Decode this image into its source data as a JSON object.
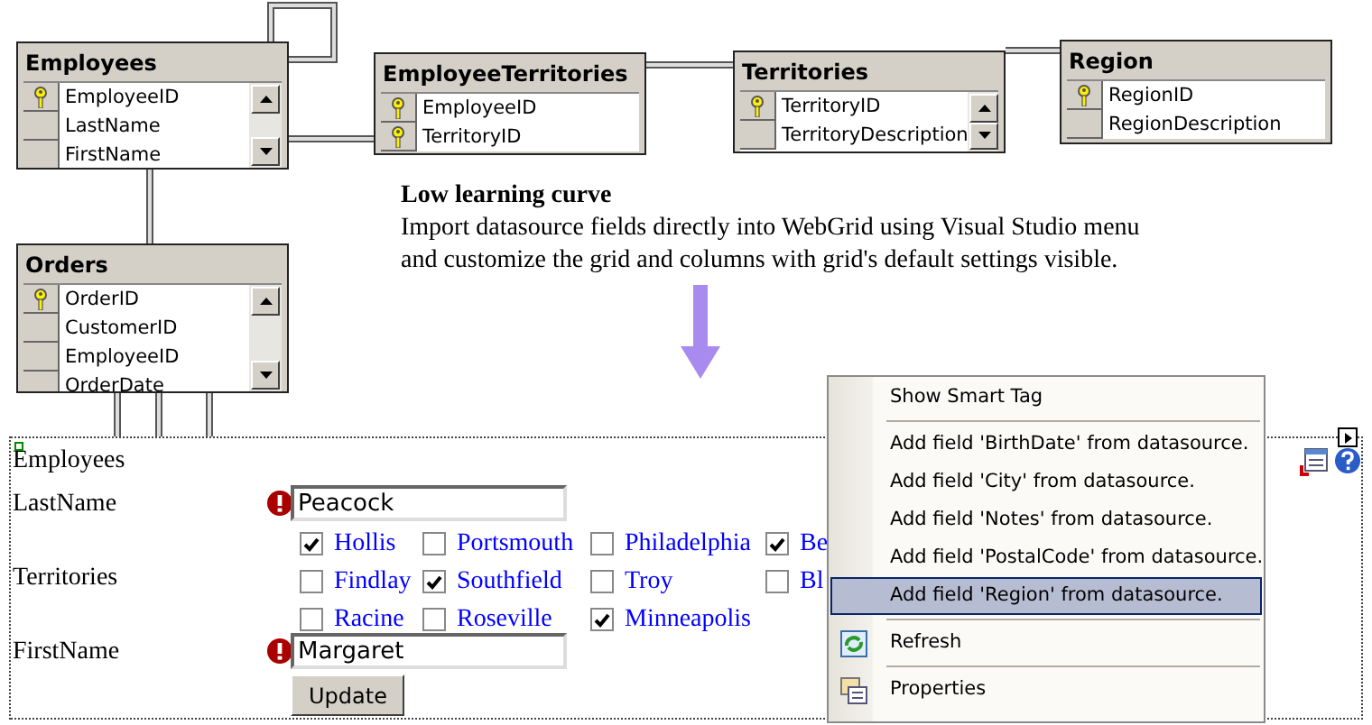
{
  "diagram": {
    "tables": [
      {
        "title": "Employees",
        "scrollbar": true,
        "columns": [
          {
            "name": "EmployeeID",
            "key": true
          },
          {
            "name": "LastName",
            "key": false
          },
          {
            "name": "FirstName",
            "key": false
          }
        ]
      },
      {
        "title": "EmployeeTerritories",
        "scrollbar": false,
        "columns": [
          {
            "name": "EmployeeID",
            "key": true
          },
          {
            "name": "TerritoryID",
            "key": true
          }
        ]
      },
      {
        "title": "Territories",
        "scrollbar": true,
        "columns": [
          {
            "name": "TerritoryID",
            "key": true
          },
          {
            "name": "TerritoryDescription",
            "key": false
          }
        ]
      },
      {
        "title": "Region",
        "scrollbar": false,
        "columns": [
          {
            "name": "RegionID",
            "key": true
          },
          {
            "name": "RegionDescription",
            "key": false
          }
        ]
      },
      {
        "title": "Orders",
        "scrollbar": true,
        "columns": [
          {
            "name": "OrderID",
            "key": true
          },
          {
            "name": "CustomerID",
            "key": false
          },
          {
            "name": "EmployeeID",
            "key": false
          },
          {
            "name": "OrderDate",
            "key": false
          }
        ]
      }
    ]
  },
  "description": {
    "heading": "Low learning curve",
    "text": "Import datasource fields directly into WebGrid using Visual Studio menu and customize the grid and columns with grid's default settings visible."
  },
  "designer": {
    "title": "Employees",
    "fields": [
      {
        "kind": "text",
        "label": "LastName",
        "value": "Peacock",
        "error": true
      },
      {
        "kind": "checklist",
        "label": "Territories",
        "items": [
          {
            "label": "Hollis",
            "checked": true
          },
          {
            "label": "Portsmouth",
            "checked": false
          },
          {
            "label": "Philadelphia",
            "checked": false
          },
          {
            "label": "Be",
            "checked": true
          },
          {
            "label": "Findlay",
            "checked": false
          },
          {
            "label": "Southfield",
            "checked": true
          },
          {
            "label": "Troy",
            "checked": false
          },
          {
            "label": "Bl",
            "checked": false
          },
          {
            "label": "Racine",
            "checked": false
          },
          {
            "label": "Roseville",
            "checked": false
          },
          {
            "label": "Minneapolis",
            "checked": true
          }
        ]
      },
      {
        "kind": "text",
        "label": "FirstName",
        "value": "Margaret",
        "error": true
      }
    ],
    "button": "Update"
  },
  "context_menu": {
    "items": [
      {
        "kind": "item",
        "label": "Show Smart Tag",
        "selected": false
      },
      {
        "kind": "separator"
      },
      {
        "kind": "item",
        "label": "Add field 'BirthDate' from datasource.",
        "selected": false
      },
      {
        "kind": "item",
        "label": "Add field 'City' from datasource.",
        "selected": false
      },
      {
        "kind": "item",
        "label": "Add field 'Notes' from datasource.",
        "selected": false
      },
      {
        "kind": "item",
        "label": "Add field 'PostalCode' from datasource.",
        "selected": false
      },
      {
        "kind": "item",
        "label": "Add field 'Region' from datasource.",
        "selected": true
      },
      {
        "kind": "separator"
      },
      {
        "kind": "item",
        "label": "Refresh",
        "selected": false
      },
      {
        "kind": "separator"
      },
      {
        "kind": "item",
        "label": "Properties",
        "selected": false
      }
    ]
  }
}
